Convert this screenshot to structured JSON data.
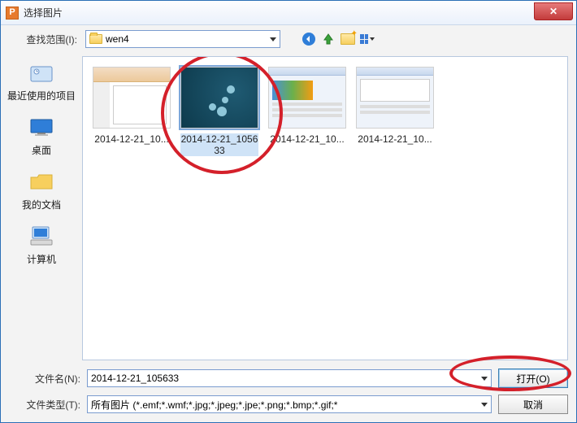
{
  "window": {
    "title": "选择图片",
    "app_icon_letter": "P"
  },
  "toolbar": {
    "lookin_label": "查找范围(I):",
    "current_folder": "wen4",
    "icons": {
      "back": "back-icon",
      "up": "up-one-level-icon",
      "new_folder": "new-folder-icon",
      "view": "view-menu-icon"
    }
  },
  "places": [
    {
      "id": "recent",
      "label": "最近使用的项目"
    },
    {
      "id": "desktop",
      "label": "桌面"
    },
    {
      "id": "mydocs",
      "label": "我的文档"
    },
    {
      "id": "computer",
      "label": "计算机"
    }
  ],
  "files": [
    {
      "caption": "2014-12-21_10...",
      "selected": false,
      "kind": "ppt"
    },
    {
      "caption": "2014-12-21_105633",
      "selected": true,
      "kind": "dark"
    },
    {
      "caption": "2014-12-21_10...",
      "selected": false,
      "kind": "panel1"
    },
    {
      "caption": "2014-12-21_10...",
      "selected": false,
      "kind": "panel2"
    }
  ],
  "bottom": {
    "filename_label": "文件名(N):",
    "filename_value": "2014-12-21_105633",
    "filetype_label": "文件类型(T):",
    "filetype_value": "所有图片 (*.emf;*.wmf;*.jpg;*.jpeg;*.jpe;*.png;*.bmp;*.gif;*",
    "open_label": "打开(O)",
    "cancel_label": "取消"
  }
}
